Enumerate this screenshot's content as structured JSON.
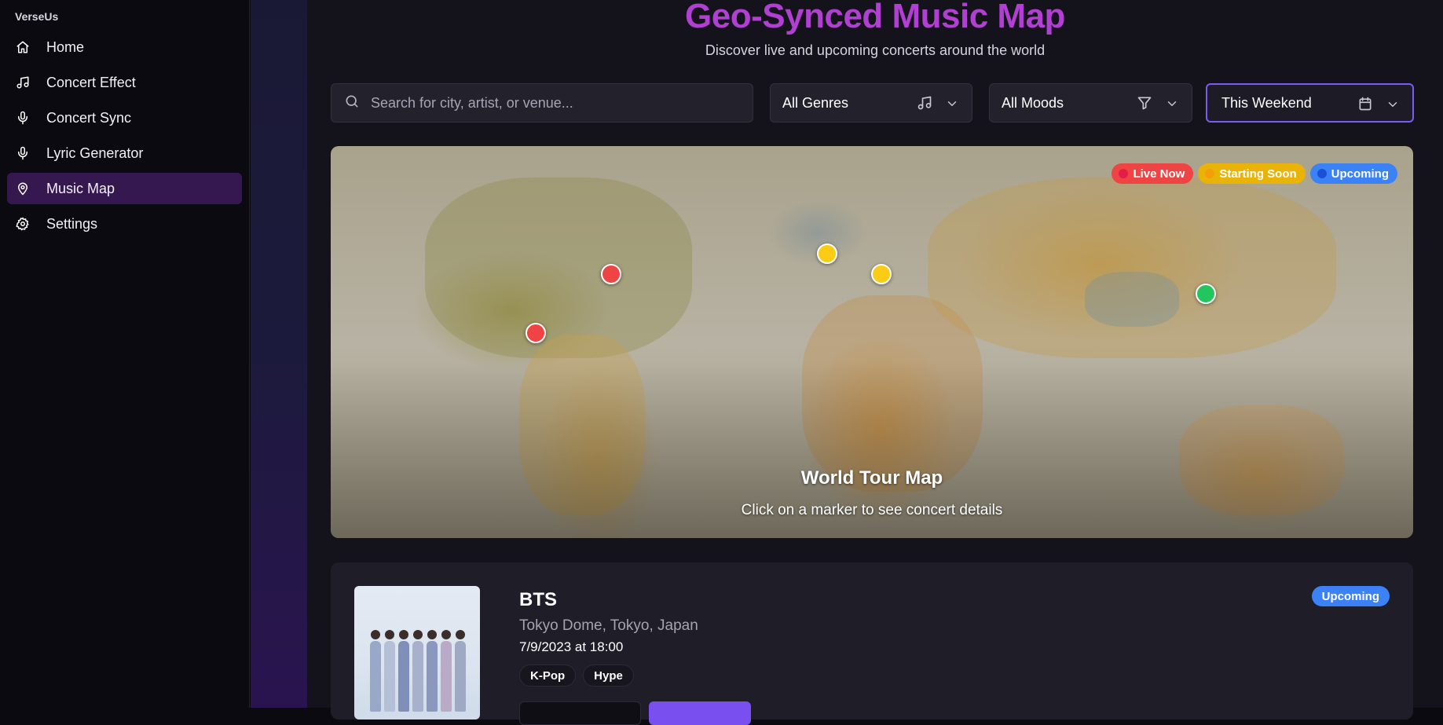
{
  "app": {
    "brand": "VerseUs"
  },
  "sidebar": {
    "items": [
      {
        "label": "Home",
        "icon": "home-icon",
        "active": false
      },
      {
        "label": "Concert Effect",
        "icon": "music-note-icon",
        "active": false
      },
      {
        "label": "Concert Sync",
        "icon": "microphone-icon",
        "active": false
      },
      {
        "label": "Lyric Generator",
        "icon": "microphone-icon",
        "active": false
      },
      {
        "label": "Music Map",
        "icon": "map-pin-icon",
        "active": true
      },
      {
        "label": "Settings",
        "icon": "gear-icon",
        "active": false
      }
    ]
  },
  "header": {
    "title": "Geo-Synced Music Map",
    "subtitle": "Discover live and upcoming concerts around the world"
  },
  "filters": {
    "search_placeholder": "Search for city, artist, or venue...",
    "search_value": "",
    "genre": {
      "selected": "All Genres",
      "icon": "music-note-icon"
    },
    "mood": {
      "selected": "All Moods",
      "icon": "filter-icon"
    },
    "date": {
      "selected": "This Weekend",
      "icon": "calendar-icon"
    }
  },
  "map": {
    "legend": [
      {
        "label": "Live Now",
        "color": "#ef4444",
        "dot": "#e11d48"
      },
      {
        "label": "Starting Soon",
        "color": "#eab308",
        "dot": "#f59e0b"
      },
      {
        "label": "Upcoming",
        "color": "#3b82f6",
        "dot": "#1d4ed8"
      }
    ],
    "marker_colors": {
      "live": "#ef4444",
      "soon": "#facc15",
      "active": "#22c55e"
    },
    "caption_title": "World Tour Map",
    "caption_subtitle": "Click on a marker to see concert details"
  },
  "concert": {
    "artist": "BTS",
    "venue": "Tokyo Dome, Tokyo, Japan",
    "datetime": "7/9/2023 at 18:00",
    "tags": [
      "K-Pop",
      "Hype"
    ],
    "status": "Upcoming",
    "status_color": "#3c82f6"
  },
  "colors": {
    "accent": "#b03fd2",
    "active_nav": "#34184f",
    "primary_button": "#7a4ff0"
  }
}
